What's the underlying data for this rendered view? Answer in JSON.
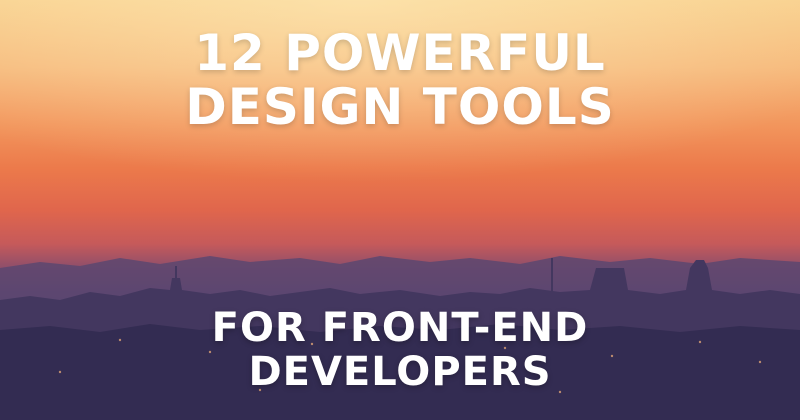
{
  "headline": {
    "line1": "12 POWERFUL",
    "line2": "DESIGN TOOLS"
  },
  "subline": {
    "line1": "FOR FRONT-END",
    "line2": "DEVELOPERS"
  },
  "colors": {
    "sky_top": "#f8cf8c",
    "sky_mid": "#ec7a4b",
    "city_dark": "#2a2a50",
    "text": "#ffffff"
  }
}
